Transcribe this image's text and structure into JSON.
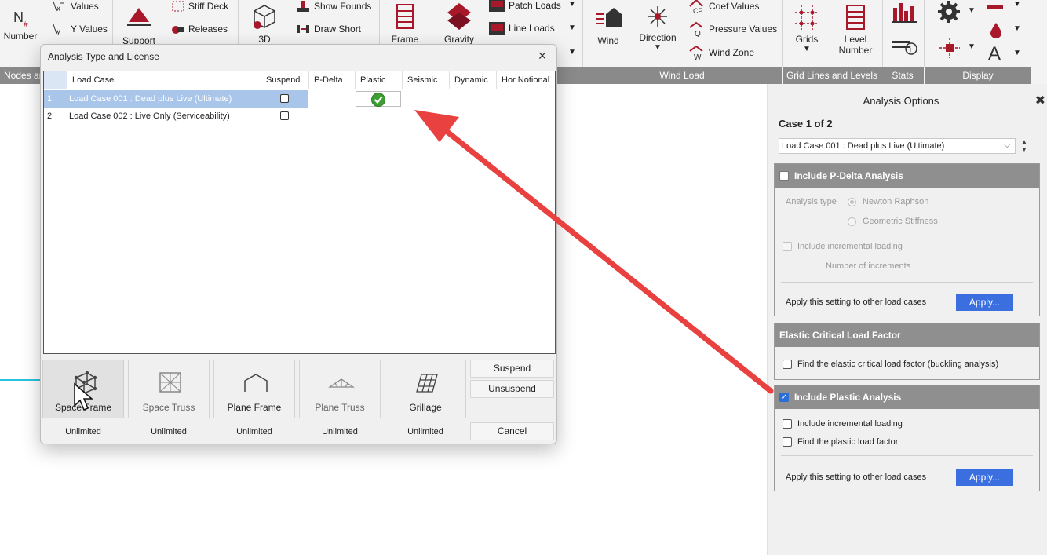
{
  "ribbon": {
    "number_label": "Number",
    "x_values": "Values",
    "y_values": "Y Values",
    "support": "Support",
    "stiff_deck": "Stiff Deck",
    "releases": "Releases",
    "three_d": "3D",
    "show_founds": "Show Founds",
    "draw_short": "Draw Short",
    "frame": "Frame",
    "gravity": "Gravity",
    "patch_loads": "Patch Loads",
    "line_loads": "Line Loads",
    "wind": "Wind",
    "direction": "Direction",
    "coef_values": "Coef Values",
    "pressure_values": "Pressure Values",
    "wind_zone": "Wind Zone",
    "grids": "Grids",
    "level_number": "Level Number",
    "groups": {
      "nodes": "Nodes ar",
      "wind_load": "Wind Load",
      "grid_lines": "Grid Lines and Levels",
      "stats": "Stats",
      "display": "Display"
    }
  },
  "dialog": {
    "title": "Analysis Type and License",
    "columns": [
      "Load Case",
      "Suspend",
      "P-Delta",
      "Plastic",
      "Seismic",
      "Dynamic",
      "Hor Notional"
    ],
    "rows": [
      {
        "num": "1",
        "name": "Load Case 001 : Dead plus Live (Ultimate)"
      },
      {
        "num": "2",
        "name": "Load Case 002 : Live Only (Serviceability)"
      }
    ],
    "types": [
      {
        "label": "Space Frame",
        "license": "Unlimited"
      },
      {
        "label": "Space Truss",
        "license": "Unlimited"
      },
      {
        "label": "Plane Frame",
        "license": "Unlimited"
      },
      {
        "label": "Plane Truss",
        "license": "Unlimited"
      },
      {
        "label": "Grillage",
        "license": "Unlimited"
      }
    ],
    "suspend": "Suspend",
    "unsuspend": "Unsuspend",
    "cancel": "Cancel"
  },
  "panel": {
    "title": "Analysis Options",
    "case_label": "Case 1 of 2",
    "case_value": "Load Case 001 : Dead plus Live (Ultimate)",
    "pdelta": {
      "header": "Include P-Delta Analysis",
      "analysis_type": "Analysis type",
      "newton": "Newton Raphson",
      "geometric": "Geometric Stiffness",
      "incremental": "Include incremental loading",
      "increments": "Number of increments",
      "apply_text": "Apply this setting to other load cases",
      "apply": "Apply..."
    },
    "elastic": {
      "header": "Elastic Critical Load Factor",
      "find": "Find the elastic critical load factor (buckling analysis)"
    },
    "plastic": {
      "header": "Include Plastic Analysis",
      "incremental": "Include incremental loading",
      "find": "Find the plastic load factor",
      "apply_text": "Apply this setting to other load cases",
      "apply": "Apply..."
    }
  },
  "colors": {
    "accent": "#3b6fe0",
    "ribbon_icon": "#a8182a",
    "arrow": "#e8413f",
    "selection": "#a9c5ea"
  }
}
